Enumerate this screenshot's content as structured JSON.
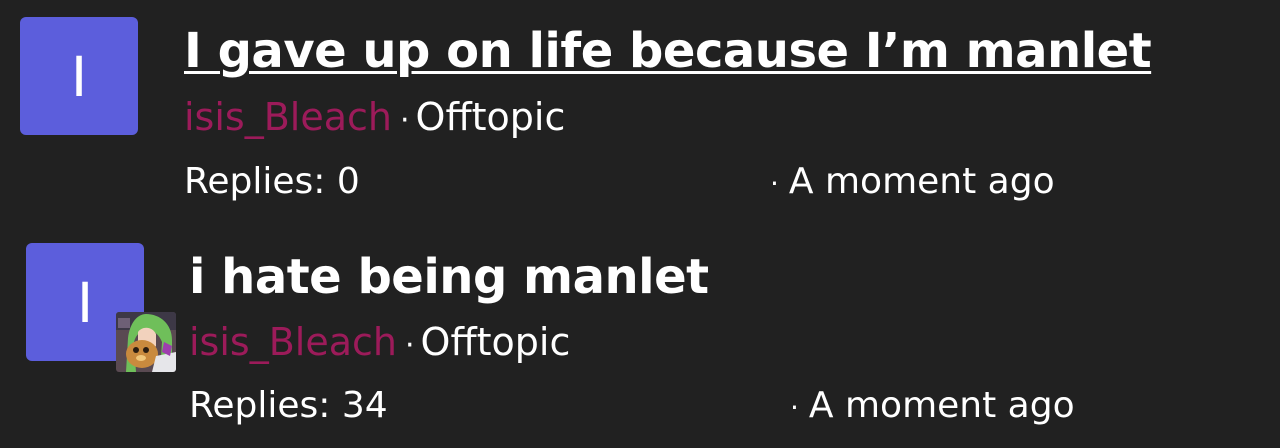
{
  "threads": [
    {
      "avatar_letter": "I",
      "avatar_color": "#5c5edc",
      "title": "I gave up on life because I’m manlet",
      "username": "isis_Bleach",
      "username_color": "#9c1b5a",
      "separator": "·",
      "category": "Offtopic",
      "replies": "Replies: 0",
      "timestamp": "A moment ago"
    },
    {
      "avatar_letter": "I",
      "avatar_color": "#5c5edc",
      "title": "i hate being manlet",
      "username": "isis_Bleach",
      "username_color": "#9c1b5a",
      "separator": "·",
      "category": "Offtopic",
      "replies": "Replies: 34",
      "timestamp": "A moment ago",
      "user_badge_image": "anime-avatar-image"
    }
  ]
}
